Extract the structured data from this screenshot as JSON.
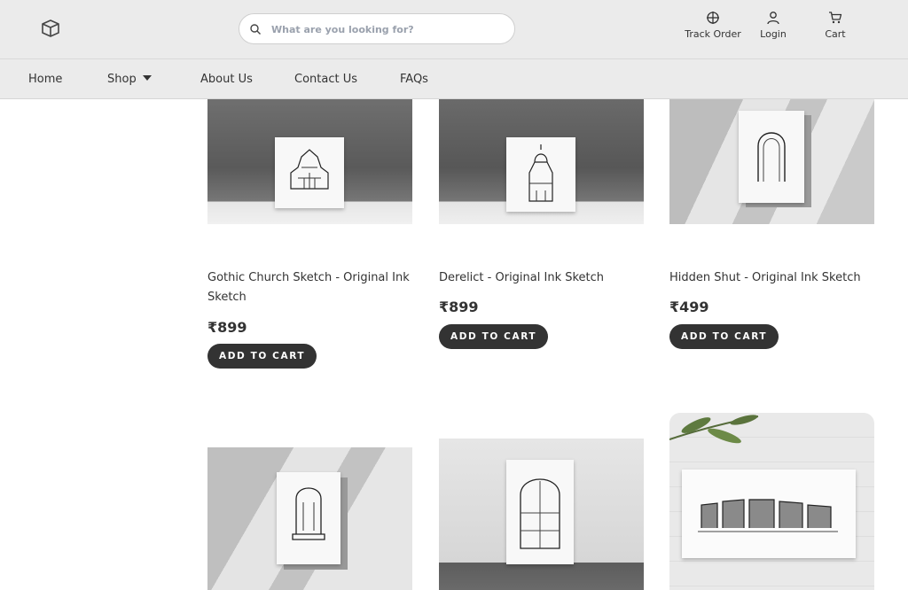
{
  "header": {
    "logo_icon": "box-logo-icon",
    "search": {
      "placeholder": "What are you looking for?",
      "value": "",
      "icon": "search-icon"
    },
    "actions": [
      {
        "label": "Track Order",
        "icon": "crosshair-icon"
      },
      {
        "label": "Login",
        "icon": "user-icon"
      },
      {
        "label": "Cart",
        "icon": "cart-icon"
      }
    ]
  },
  "nav": {
    "items": [
      "Home",
      "Shop",
      "About Us",
      "Contact Us",
      "FAQs"
    ],
    "shop_icon": "caret-down-icon"
  },
  "products": [
    {
      "title": "Gothic Church Sketch - Original Ink Sketch",
      "price": "₹899",
      "button": "ADD TO CART"
    },
    {
      "title": "Derelict - Original Ink Sketch",
      "price": "₹899",
      "button": "ADD TO CART"
    },
    {
      "title": "Hidden Shut - Original Ink Sketch",
      "price": "₹499",
      "button": "ADD TO CART"
    }
  ],
  "colors": {
    "header_bg": "#ebebeb",
    "button_bg": "#333333",
    "text": "#333333"
  }
}
